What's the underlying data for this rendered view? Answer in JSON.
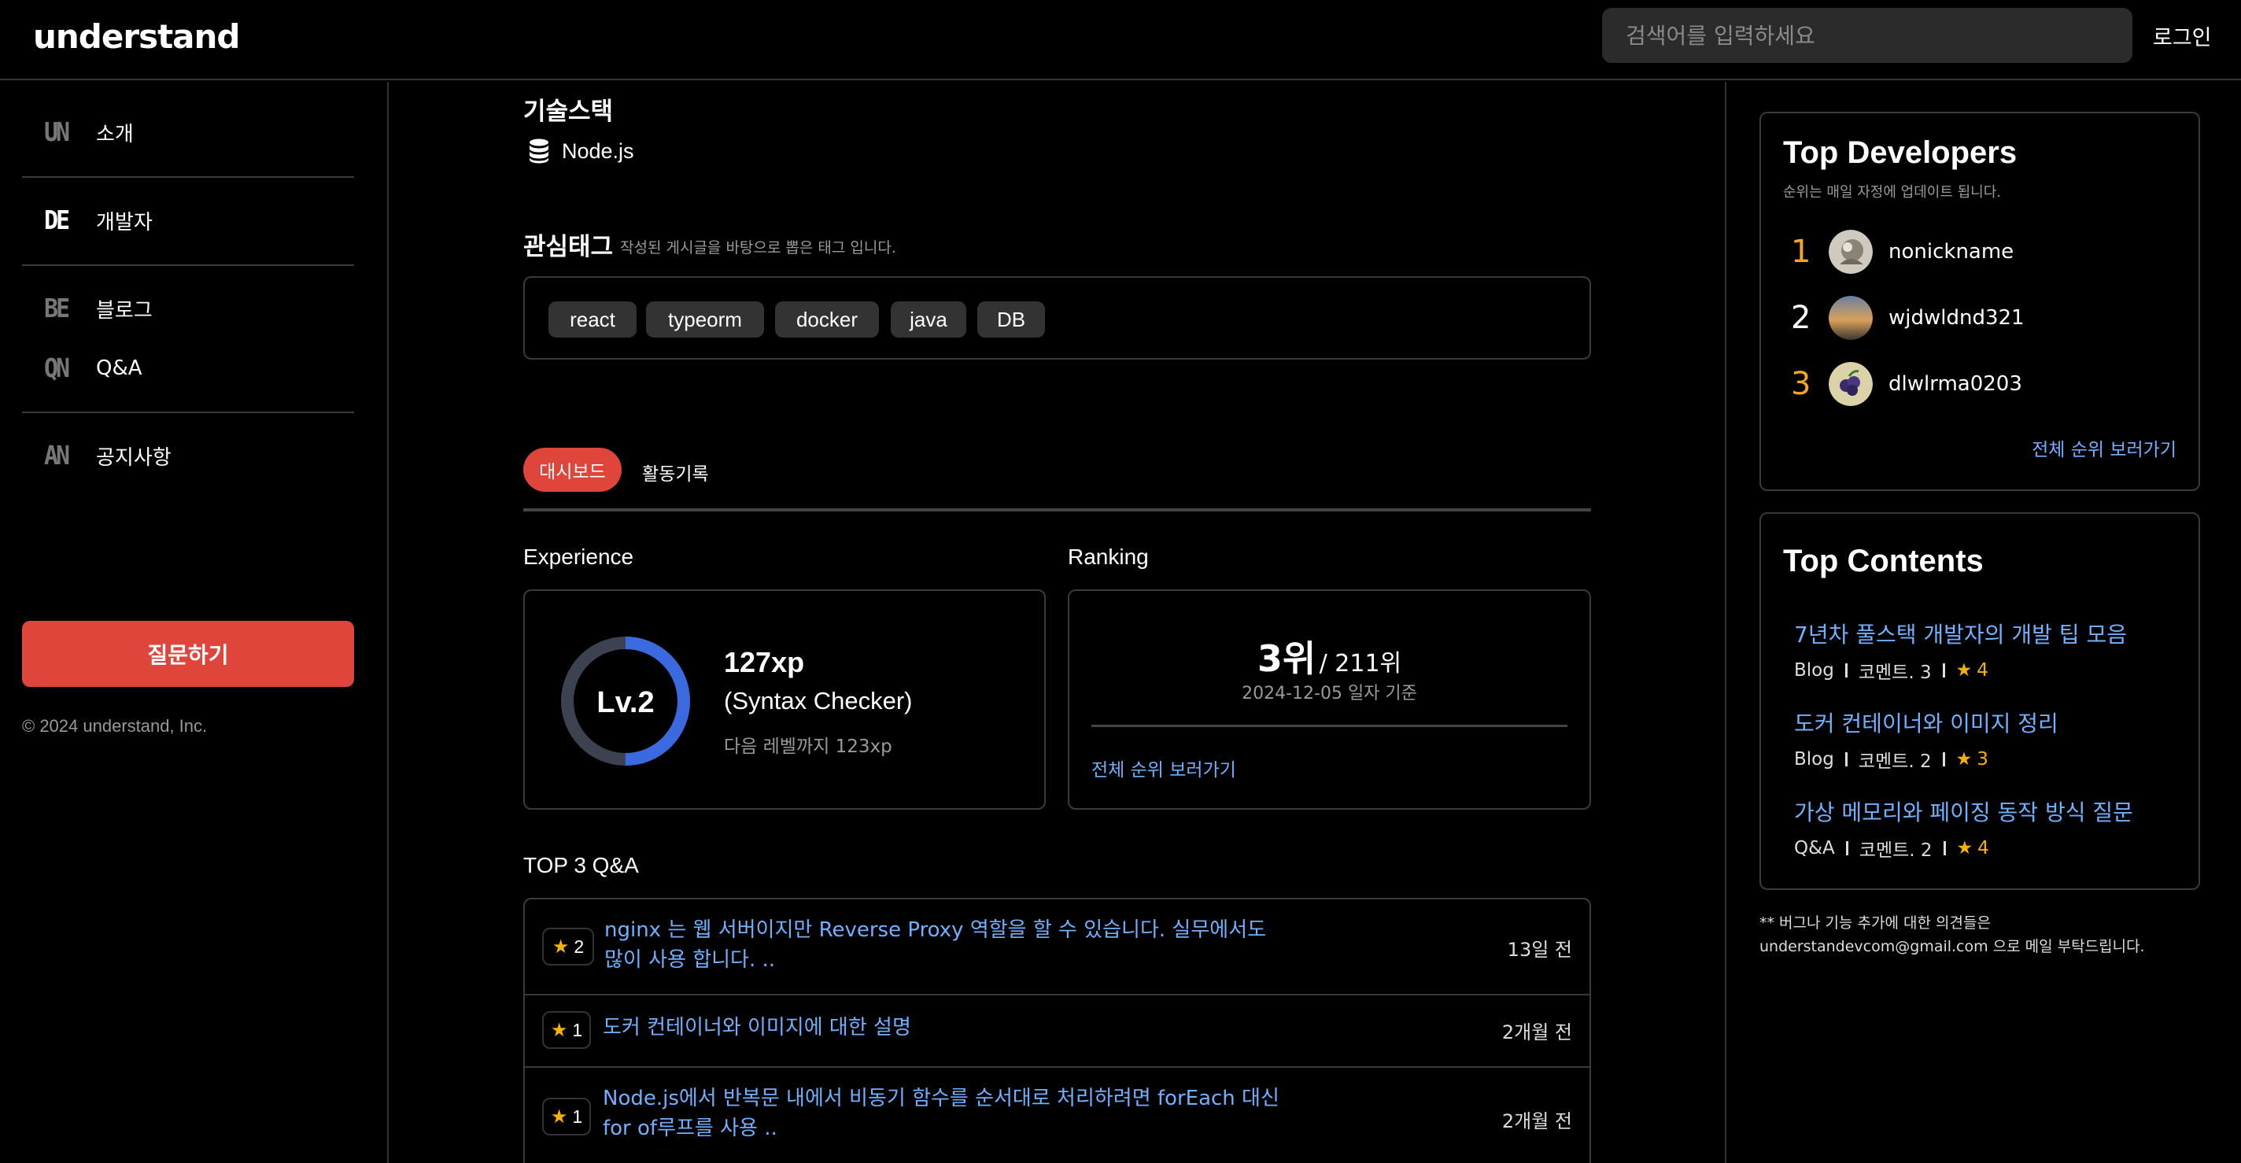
{
  "header": {
    "logo": "understand",
    "search_placeholder": "검색어를 입력하세요",
    "login_label": "로그인"
  },
  "sidebar": {
    "items": [
      {
        "abbr": "UN",
        "label": "소개"
      },
      {
        "abbr": "DE",
        "label": "개발자"
      },
      {
        "abbr": "BE",
        "label": "블로그"
      },
      {
        "abbr": "QN",
        "label": "Q&A"
      },
      {
        "abbr": "AN",
        "label": "공지사항"
      }
    ],
    "ask_button": "질문하기",
    "copyright": "© 2024 understand, Inc."
  },
  "profile": {
    "stack_title": "기술스택",
    "stack_items": [
      "Node.js"
    ],
    "tags_title": "관심태그",
    "tags_note": "작성된 게시글을 바탕으로 뽑은 태그 입니다.",
    "tags": [
      "react",
      "typeorm",
      "docker",
      "java",
      "DB"
    ]
  },
  "tabs": {
    "dashboard": "대시보드",
    "activity": "활동기록"
  },
  "experience": {
    "title": "Experience",
    "level": "Lv.2",
    "xp": "127xp",
    "level_name": "(Syntax Checker)",
    "next_level": "다음 레벨까지 123xp",
    "progress_fraction": 0.5,
    "colors": {
      "progress": "#3b6ae0",
      "track": "#3d4250"
    }
  },
  "ranking": {
    "title": "Ranking",
    "rank": "3위",
    "total": "/ 211위",
    "date": "2024-12-05 일자 기준",
    "link": "전체 순위 보러가기"
  },
  "top_qa": {
    "title": "TOP 3 Q&A",
    "items": [
      {
        "stars": "2",
        "text": "nginx 는 웹 서버이지만 Reverse Proxy 역할을 할 수 있습니다. 실무에서도 많이 사용 합니다. ..",
        "time": "13일 전"
      },
      {
        "stars": "1",
        "text": "도커 컨테이너와 이미지에 대한 설명",
        "time": "2개월 전"
      },
      {
        "stars": "1",
        "text": "Node.js에서 반복문 내에서 비동기 함수를 순서대로 처리하려면 forEach 대신 for of루프를 사용 ..",
        "time": "2개월 전"
      }
    ]
  },
  "top_developers": {
    "title": "Top Developers",
    "subtitle": "순위는 매일 자정에 업데이트 됩니다.",
    "items": [
      {
        "rank": "1",
        "name": "nonickname",
        "rank_color": "#f5a623"
      },
      {
        "rank": "2",
        "name": "wjdwldnd321",
        "rank_color": "#ffffff"
      },
      {
        "rank": "3",
        "name": "dlwlrma0203",
        "rank_color": "#f5a623"
      }
    ],
    "link": "전체 순위 보러가기"
  },
  "top_contents": {
    "title": "Top Contents",
    "items": [
      {
        "title": "7년차 풀스택 개발자의 개발 팁 모음",
        "category": "Blog",
        "comments": "코멘트. 3",
        "stars": "4"
      },
      {
        "title": "도커 컨테이너와 이미지 정리",
        "category": "Blog",
        "comments": "코멘트. 2",
        "stars": "3"
      },
      {
        "title": "가상 메모리와 페이징 동작 방식 질문",
        "category": "Q&A",
        "comments": "코멘트. 2",
        "stars": "4"
      }
    ]
  },
  "feedback": {
    "line1": "** 버그나 기능 추가에 대한 의견들은",
    "line2": "understandevcom@gmail.com 으로 메일 부탁드립니다."
  }
}
